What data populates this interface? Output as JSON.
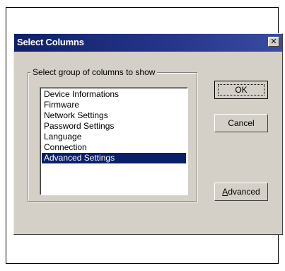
{
  "dialog": {
    "title": "Select Columns",
    "close_glyph": "✕",
    "group_label": "Select group of columns to show",
    "columns": [
      "Device Informations",
      "Firmware",
      "Network Settings",
      "Password Settings",
      "Language",
      "Connection",
      "Advanced Settings"
    ],
    "selected_column": "Advanced Settings",
    "buttons": {
      "ok": "OK",
      "cancel": "Cancel",
      "advanced_first": "A",
      "advanced_rest": "dvanced"
    }
  },
  "colors": {
    "titlebar": "#0f2068",
    "selection": "#0b1f6a",
    "face": "#d4d0c8"
  }
}
